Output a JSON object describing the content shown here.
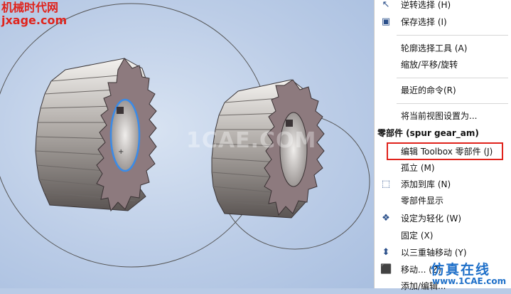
{
  "watermark": {
    "line1": "机械时代网",
    "line2": "jxage.com",
    "center": "1CAE.COM",
    "brand": "仿真在线",
    "url": "www.1CAE.com"
  },
  "top_left_label": "≪⊕",
  "menu": {
    "items_top": [
      {
        "label": "逆转选择 (H)",
        "icon": "cursor-arrow-icon"
      },
      {
        "label": "保存选择 (I)",
        "icon": "save-selection-icon"
      },
      {
        "label": "轮廓选择工具 (A)",
        "icon": ""
      },
      {
        "label": "缩放/平移/旋转",
        "icon": ""
      },
      {
        "label": "最近的命令(R)",
        "icon": ""
      },
      {
        "label": "将当前视图设置为...",
        "icon": ""
      }
    ],
    "section_header": "零部件 (spur gear_am)",
    "items_component": [
      {
        "label": "编辑 Toolbox 零部件 (J)",
        "icon": ""
      },
      {
        "label": "孤立 (M)",
        "icon": ""
      },
      {
        "label": "添加到库 (N)",
        "icon": "add-to-library-icon"
      },
      {
        "label": "零部件显示",
        "icon": ""
      },
      {
        "label": "设定为轻化 (W)",
        "icon": "lightweight-icon"
      },
      {
        "label": "固定 (X)",
        "icon": ""
      },
      {
        "label": "以三重轴移动 (Y)",
        "icon": "triad-move-icon"
      },
      {
        "label": "移动... (Z)",
        "icon": "move-icon"
      },
      {
        "label": "添加/编辑...",
        "icon": ""
      }
    ]
  },
  "colors": {
    "highlight": "#e0231c",
    "gear_face": "#8d7a7e",
    "gear_teeth": "#d8d4d2"
  }
}
